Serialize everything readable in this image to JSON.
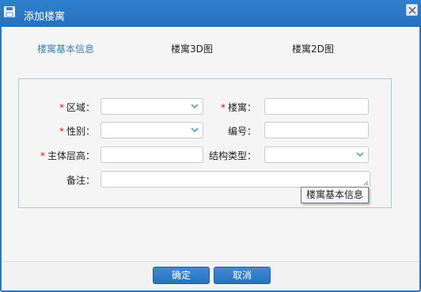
{
  "dialog": {
    "title": "添加楼寓",
    "icon": "save-icon"
  },
  "tabs": [
    {
      "label": "楼寓基本信息",
      "active": true
    },
    {
      "label": "楼寓3D图",
      "active": false
    },
    {
      "label": "楼寓2D图",
      "active": false
    }
  ],
  "form": {
    "region_label": "区域：",
    "building_label": "楼寓：",
    "gender_label": "性别：",
    "number_label": "编号：",
    "main_floor_label": "主体层高：",
    "structure_label": "结构类型：",
    "remark_label": "备注：",
    "required_mark": "*"
  },
  "tooltip": "楼寓基本信息",
  "buttons": {
    "confirm": "确定",
    "cancel": "取消"
  },
  "colors": {
    "titlebar": "#2876c4",
    "accent": "#3a7fbf",
    "required": "#d11111"
  }
}
